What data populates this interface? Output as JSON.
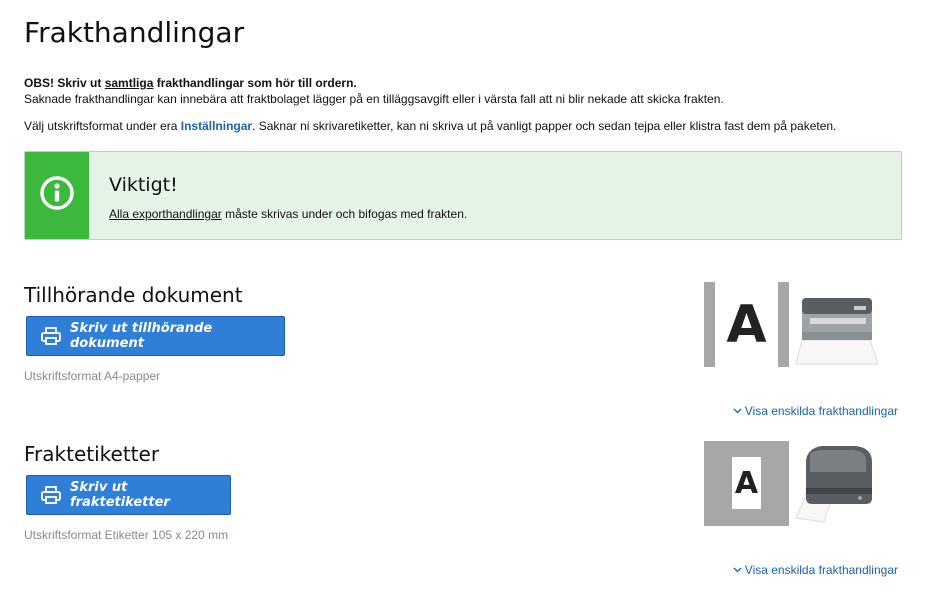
{
  "page": {
    "title": "Frakthandlingar"
  },
  "intro": {
    "line1_bold_prefix": "OBS! Skriv ut ",
    "line1_underlined": "samtliga",
    "line1_bold_suffix": " frakthandlingar som hör till ordern.",
    "line2": "Saknade frakthandlingar kan innebära att fraktbolaget lägger på en tilläggsavgift eller i värsta fall att ni blir nekade att skicka frakten.",
    "line3_prefix": "Välj utskriftsformat under era ",
    "line3_link": "Inställningar",
    "line3_suffix": ". Saknar ni skrivaretiketter, kan ni skriva ut på vanligt papper och sedan tejpa eller klistra fast dem på paketen."
  },
  "notice": {
    "title": "Viktigt!",
    "text_link": "Alla exporthandlingar",
    "text_suffix": " måste skrivas under och bifogas med frakten.",
    "icon": "info-circle-icon",
    "accent_color": "#3cb93c",
    "background_color": "#e6f4e8"
  },
  "sections": [
    {
      "title": "Tillhörande dokument",
      "button_label": "Skriv ut tillhörande dokument",
      "format_text": "Utskriftsformat A4-papper",
      "toggle_label": "Visa enskilda frakthandlingar",
      "paper_letter": "A"
    },
    {
      "title": "Fraktetiketter",
      "button_label": "Skriv ut fraktetiketter",
      "format_text": "Utskriftsformat Etiketter 105 x 220 mm",
      "toggle_label": "Visa enskilda frakthandlingar",
      "paper_letter": "A"
    }
  ],
  "colors": {
    "button": "#2f7ed8",
    "link": "#1a63b8"
  }
}
